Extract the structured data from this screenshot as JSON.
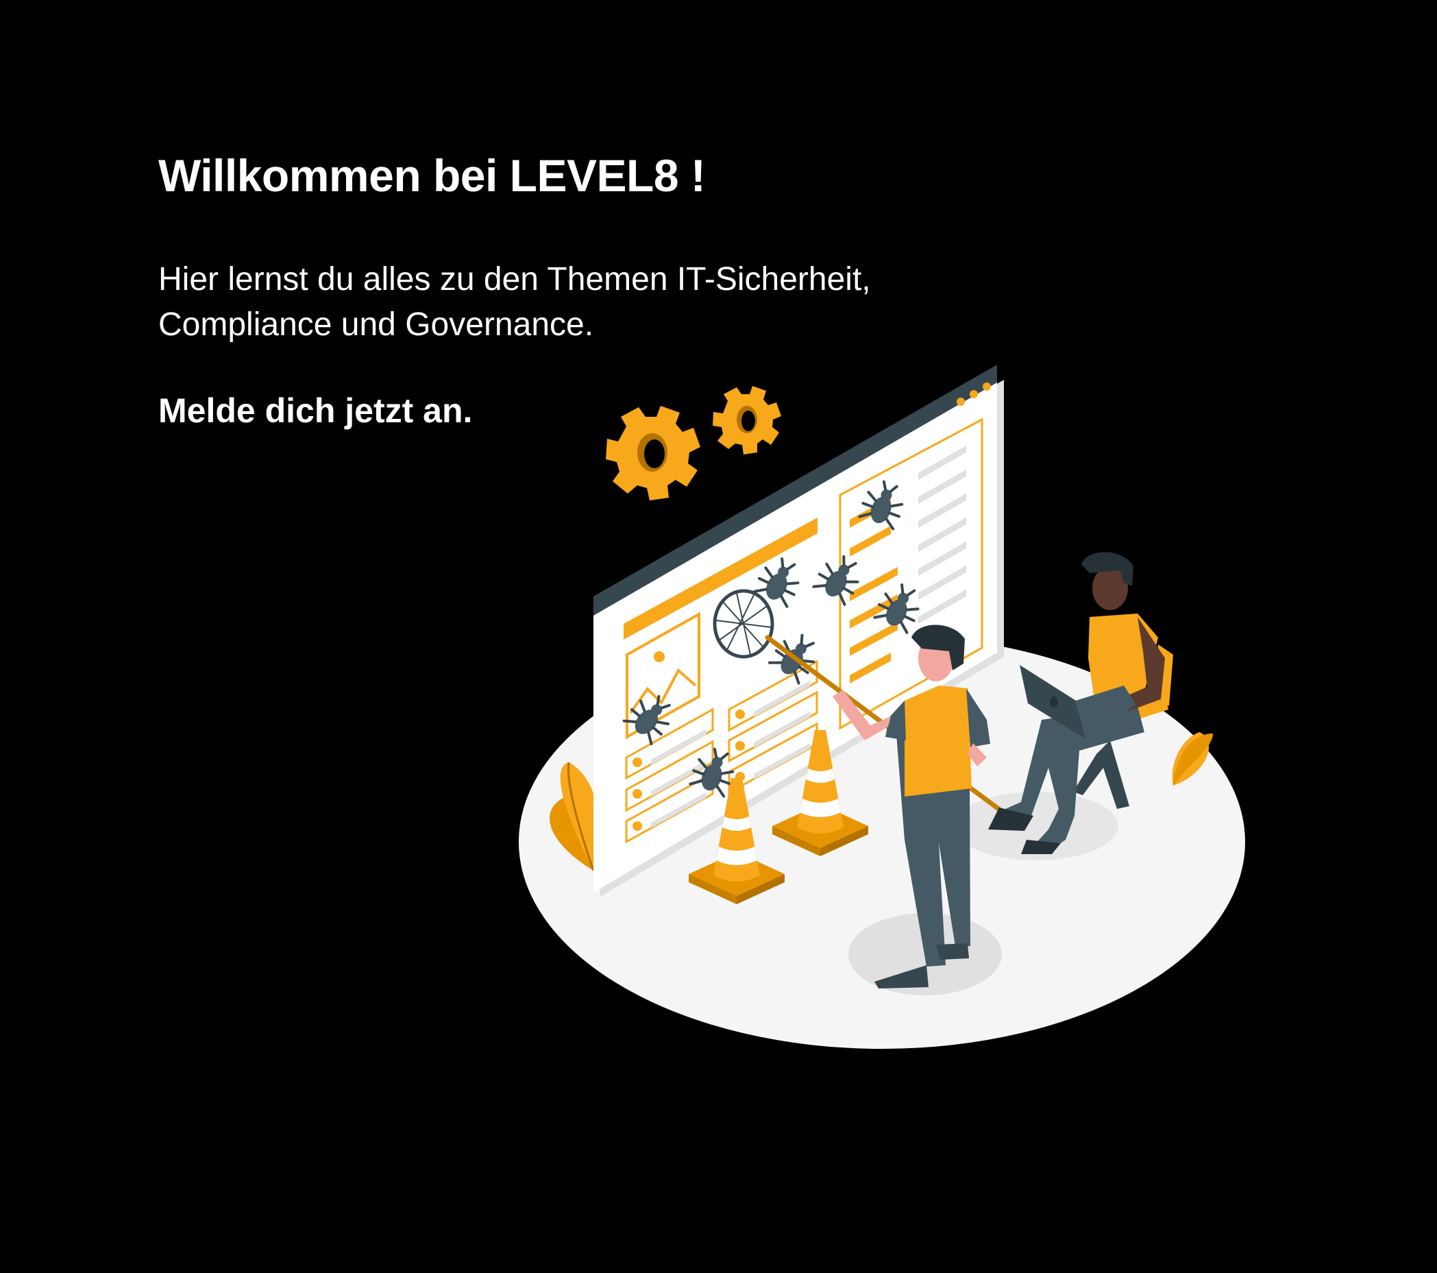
{
  "welcome": {
    "title": "Willkommen bei LEVEL8 !",
    "intro_line1": "Hier lernst du alles zu den Themen IT-Sicherheit,",
    "intro_line2": "Compliance und Governance.",
    "cta": "Melde dich jetzt an."
  },
  "colors": {
    "background": "#000000",
    "text": "#ffffff",
    "accent": "#F7A81B",
    "dark": "#37474F",
    "floor": "#F5F5F5"
  },
  "illustration": {
    "icons": [
      "gear-icon",
      "bug-icon",
      "traffic-cone-icon",
      "bug-net-icon",
      "plant-icon",
      "laptop-icon"
    ]
  }
}
